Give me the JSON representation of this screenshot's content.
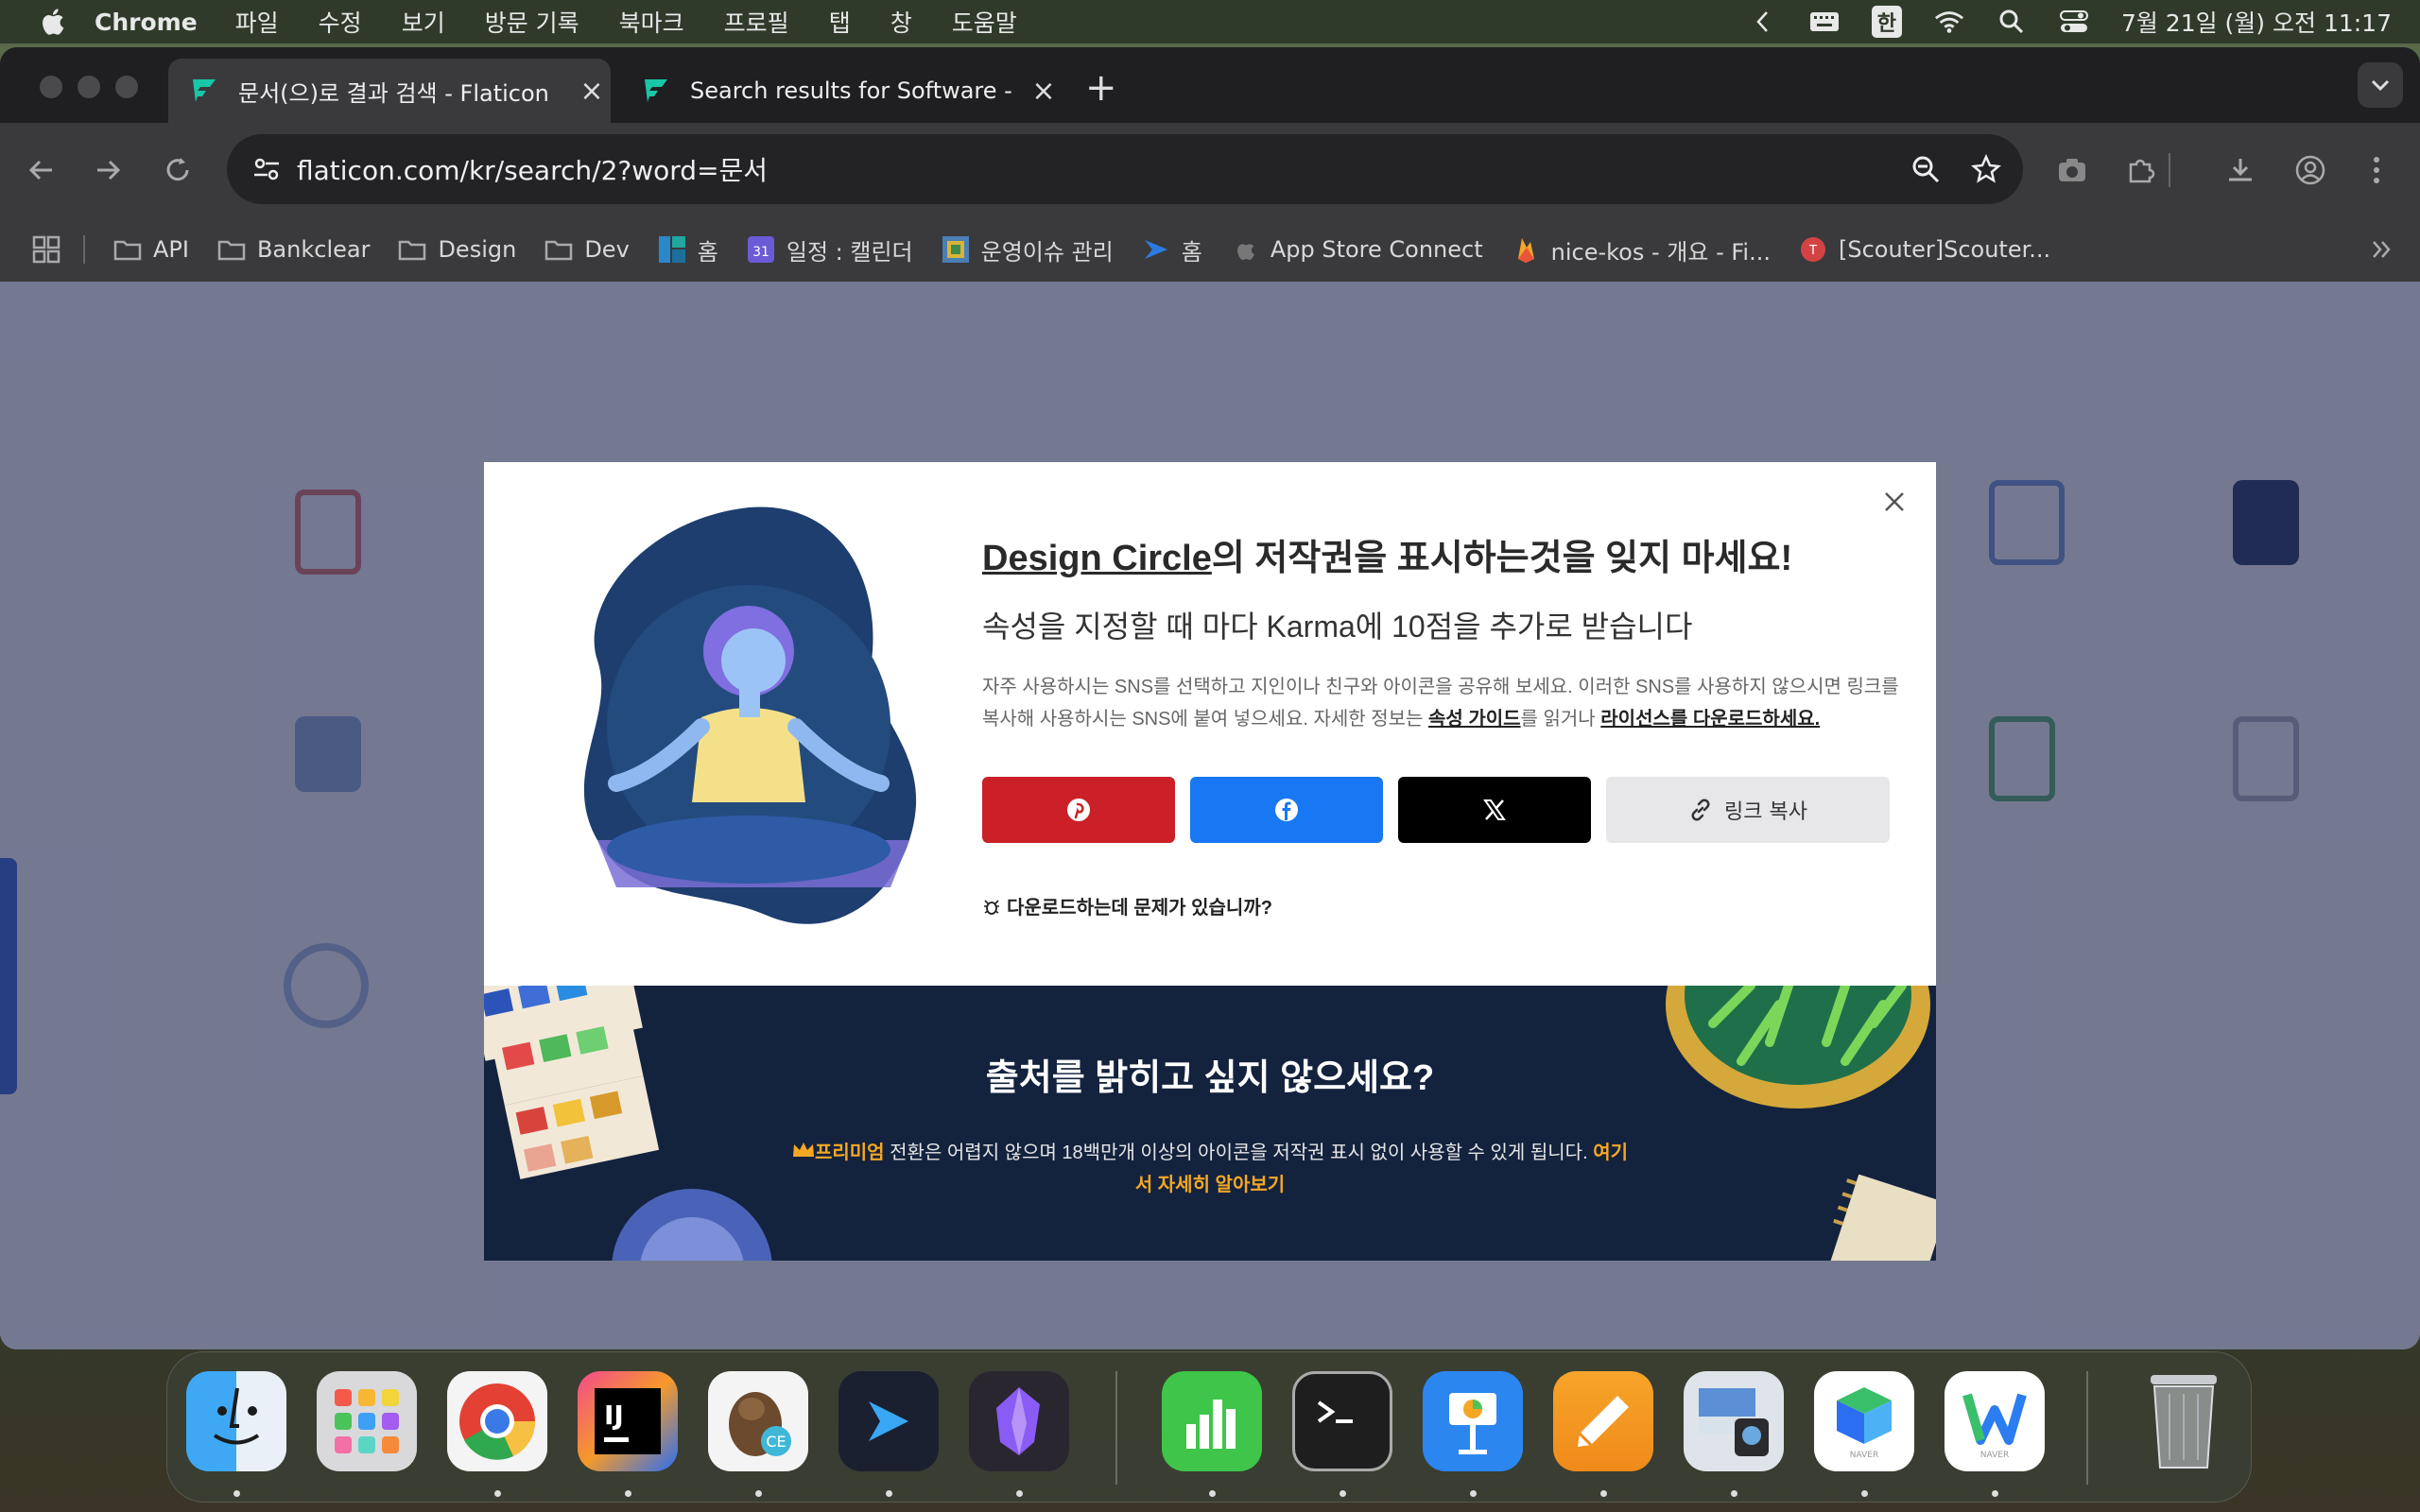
{
  "menubar": {
    "app_name": "Chrome",
    "items": [
      "파일",
      "수정",
      "보기",
      "방문 기록",
      "북마크",
      "프로필",
      "탭",
      "창",
      "도움말"
    ],
    "input_method": "한",
    "datetime": "7월 21일 (월) 오전 11:17"
  },
  "tabs": [
    {
      "title": "문서(으)로 결과 검색 - Flaticon",
      "active": true
    },
    {
      "title": "Search results for Software - ",
      "active": false
    }
  ],
  "toolbar": {
    "url": "flaticon.com/kr/search/2?word=문서"
  },
  "bookmarks": [
    {
      "label": "API",
      "icon": "folder-icon"
    },
    {
      "label": "Bankclear",
      "icon": "folder-icon"
    },
    {
      "label": "Design",
      "icon": "folder-icon"
    },
    {
      "label": "Dev",
      "icon": "folder-icon"
    },
    {
      "label": "홈",
      "icon": "app-icon"
    },
    {
      "label": "일정 : 캘린더",
      "icon": "calendar-icon"
    },
    {
      "label": "운영이슈 관리",
      "icon": "app-icon"
    },
    {
      "label": "홈",
      "icon": "app-icon"
    },
    {
      "label": "App Store Connect",
      "icon": "apple-icon"
    },
    {
      "label": "nice-kos - 개요 - Fi...",
      "icon": "firebase-icon"
    },
    {
      "label": "[Scouter]Scouter...",
      "icon": "app-icon"
    }
  ],
  "modal": {
    "title_link": "Design Circle",
    "title_rest": "의 저작권을 표시하는것을 잊지 마세요!",
    "subtitle": "속성을 지정할 때 마다 Karma에 10점을 추가로 받습니다",
    "desc_1": "자주 사용하시는 SNS를 선택하고 지인이나 친구와 아이콘을 공유해 보세요. 이러한 SNS를 사용하지 않으시면 링크를 복사해 사용하시는 SNS에 붙여 넣으세요. 자세한 정보는 ",
    "desc_link_1": "속성 가이드",
    "desc_2": "를 읽거나 ",
    "desc_link_2": "라이선스를 다운로드하세요.",
    "copy_link": "링크 복사",
    "problem": "다운로드하는데 문제가 있습니까?",
    "promo_title": "출처를 밝히고 싶지 않으세요?",
    "promo_premium": "프리미엄",
    "promo_desc": " 전환은 어렵지 않으며 18백만개 이상의 아이콘을 저작권 표시 없이 사용할 수 있게 됩니다. ",
    "promo_link": "여기서 자세히 알아보기"
  },
  "colors": {
    "pinterest": "#cb2027",
    "facebook": "#1877f2",
    "x": "#000000",
    "promo_bg": "#13233e",
    "accent_orange": "#f7a823"
  },
  "dock": [
    {
      "name": "Finder",
      "running": true
    },
    {
      "name": "Launchpad",
      "running": false
    },
    {
      "name": "Chrome",
      "running": true
    },
    {
      "name": "IntelliJ IDEA",
      "running": true
    },
    {
      "name": "DBeaver",
      "running": true
    },
    {
      "name": "Prompt",
      "running": true
    },
    {
      "name": "Obsidian",
      "running": true
    },
    {
      "name": "Numbers",
      "running": true
    },
    {
      "name": "Terminal",
      "running": true
    },
    {
      "name": "Keynote",
      "running": true
    },
    {
      "name": "Pages",
      "running": true
    },
    {
      "name": "Preview",
      "running": true
    },
    {
      "name": "Naver Works",
      "running": true
    },
    {
      "name": "Naver Whale",
      "running": true
    },
    {
      "name": "Trash",
      "running": false
    }
  ]
}
